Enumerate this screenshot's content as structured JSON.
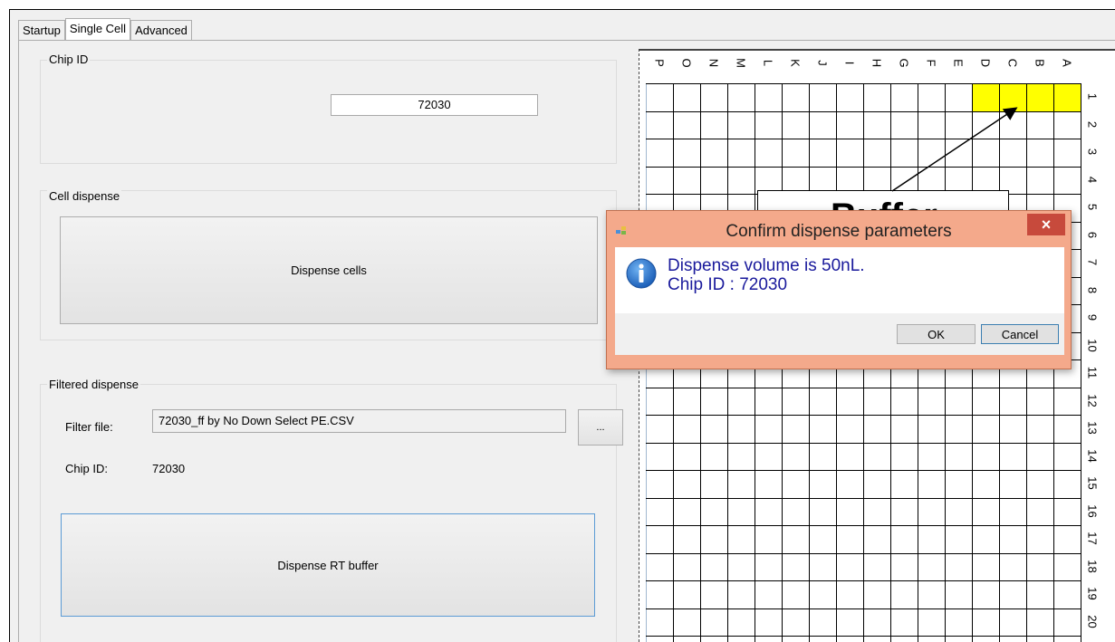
{
  "tabs": [
    {
      "label": "Startup",
      "active": false
    },
    {
      "label": "Single Cell",
      "active": true
    },
    {
      "label": "Advanced",
      "active": false
    }
  ],
  "chip_group": {
    "title": "Chip ID",
    "value": "72030"
  },
  "cell_dispense": {
    "title": "Cell dispense",
    "button": "Dispense cells"
  },
  "filtered_dispense": {
    "title": "Filtered dispense",
    "filter_label": "Filter file:",
    "filter_value": "72030_ff by No Down Select PE.CSV",
    "browse_label": "...",
    "chip_label": "Chip ID:",
    "chip_value": "72030",
    "button": "Dispense RT buffer"
  },
  "grid": {
    "columns": [
      "P",
      "O",
      "N",
      "M",
      "L",
      "K",
      "J",
      "I",
      "H",
      "G",
      "F",
      "E",
      "D",
      "C",
      "B",
      "A"
    ],
    "rows": [
      "1",
      "2",
      "3",
      "4",
      "5",
      "6",
      "7",
      "8",
      "9",
      "10",
      "11",
      "12",
      "13",
      "14",
      "15",
      "16",
      "17",
      "18",
      "19",
      "20"
    ],
    "highlight_color": "#ffff00",
    "highlighted_cells": [
      "D1",
      "C1",
      "B1",
      "A1"
    ]
  },
  "callout": {
    "text": "Buffer"
  },
  "dialog": {
    "title": "Confirm dispense parameters",
    "line1": "Dispense volume is 50nL.",
    "line2": "Chip ID : 72030",
    "ok_label": "OK",
    "cancel_label": "Cancel",
    "close_label": "×",
    "title_bar_color": "#f4a98b"
  }
}
